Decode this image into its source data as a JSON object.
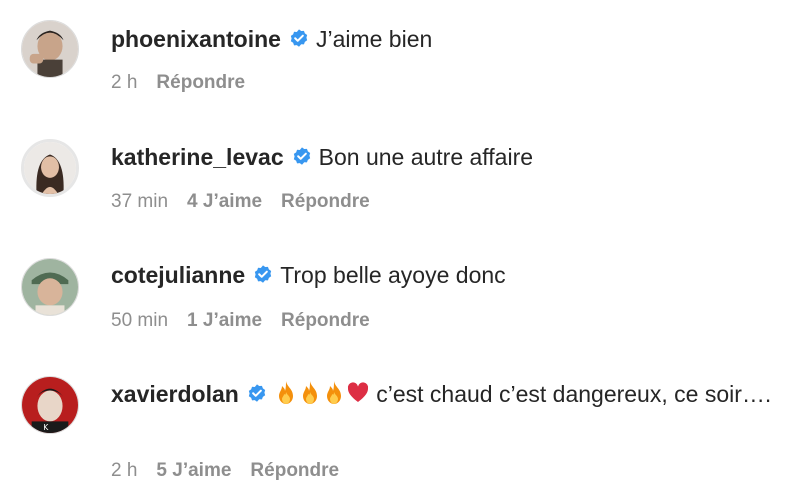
{
  "comments": [
    {
      "username": "phoenixantoine",
      "text": "J’aime bien",
      "time": "2 h",
      "likes": "",
      "reply_label": "Répondre",
      "avatar_icon": "avatar-photo"
    },
    {
      "username": "katherine_levac",
      "text": "Bon une autre affaire",
      "time": "37 min",
      "likes": "4 J’aime",
      "reply_label": "Répondre",
      "avatar_icon": "avatar-photo"
    },
    {
      "username": "cotejulianne",
      "text": "Trop belle ayoye donc",
      "time": "50 min",
      "likes": "1 J’aime",
      "reply_label": "Répondre",
      "avatar_icon": "avatar-photo"
    },
    {
      "username": "xavierdolan",
      "emojis": [
        "fire-emoji",
        "fire-emoji",
        "fire-emoji",
        "red-heart-emoji"
      ],
      "text": " c’est chaud c’est dangereux, ce soir….",
      "time": "2 h",
      "likes": "5 J’aime",
      "reply_label": "Répondre",
      "avatar_icon": "avatar-photo"
    }
  ],
  "colors": {
    "verified_badge": "#3897f0",
    "meta_text": "#8e8e8e",
    "primary_text": "#262626",
    "fire": "#f4900c",
    "heart": "#dd2e44"
  }
}
